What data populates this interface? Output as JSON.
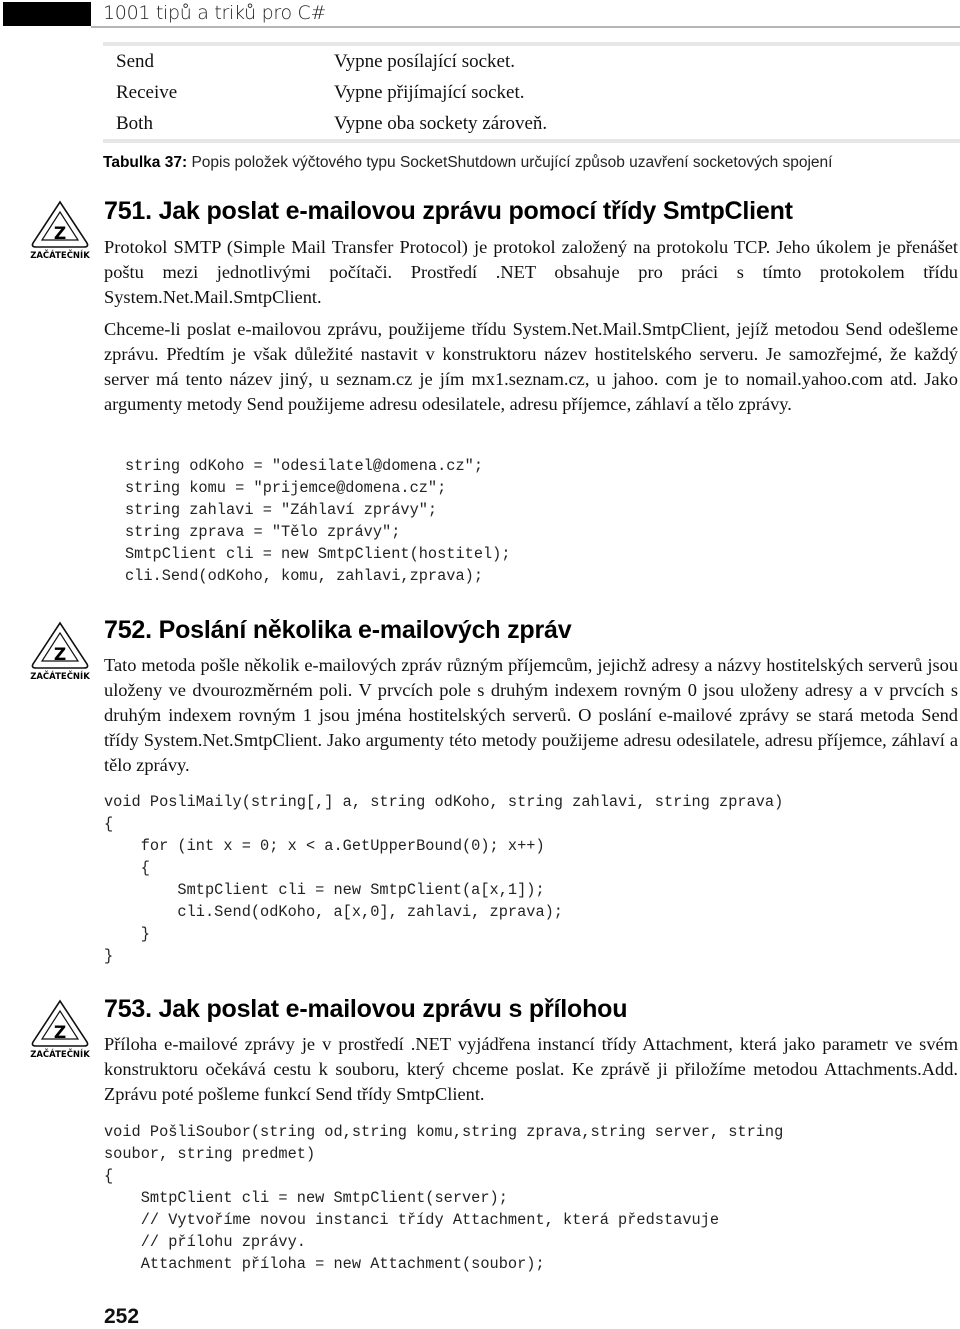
{
  "header": {
    "title": "1001 tipů a triků pro C#"
  },
  "table": {
    "rows": [
      {
        "key": "Send",
        "value": "Vypne posílající socket."
      },
      {
        "key": "Receive",
        "value": "Vypne přijímající socket."
      },
      {
        "key": "Both",
        "value": "Vypne oba sockety zároveň."
      }
    ],
    "caption_label": "Tabulka 37:",
    "caption_text": " Popis položek výčtového typu SocketShutdown určující způsob uzavření socketových spojení"
  },
  "badge": {
    "label": "ZAČÁTEČNÍK",
    "letter": "Z",
    "icon": "beginner-triangle-icon"
  },
  "sections": [
    {
      "title": "751. Jak poslat e-mailovou zprávu pomocí třídy SmtpClient",
      "paragraphs": [
        "Protokol SMTP (Simple Mail Transfer Protocol) je protokol založený na protokolu TCP. Jeho úkolem je přenášet poštu mezi jednotlivými počítači. Prostředí .NET obsahuje pro práci s tímto protokolem třídu System.Net.Mail.SmtpClient.",
        "Chceme-li poslat e-mailovou zprávu, použijeme třídu System.Net.Mail.SmtpClient, jejíž metodou Send odešleme zprávu. Předtím je však důležité nastavit v konstruktoru název hostitelského serveru. Je samozřejmé, že každý server má tento název jiný, u seznam.cz je jím mx1.seznam.cz, u jahoo. com je to nomail.yahoo.com atd. Jako argumenty metody Send použijeme adresu odesilatele, adresu příjemce, záhlaví a tělo zprávy."
      ],
      "code": [
        "string odKoho = \"odesilatel@domena.cz\";",
        "string komu = \"prijemce@domena.cz\";",
        "string zahlavi = \"Záhlaví zprávy\";",
        "string zprava = \"Tělo zprávy\";",
        "SmtpClient cli = new SmtpClient(hostitel);",
        "cli.Send(odKoho, komu, zahlavi,zprava);"
      ]
    },
    {
      "title": "752. Poslání několika e-mailových zpráv",
      "paragraphs": [
        "Tato metoda pošle několik e-mailových zpráv různým příjemcům, jejichž adresy a názvy hostitelských serverů jsou uloženy ve dvourozměrném poli. V prvcích pole s druhým indexem rovným 0 jsou uloženy adresy a v prvcích s druhým indexem rovným 1 jsou jména hostitelských serverů. O poslání e-mailové zprávy se stará metoda Send třídy System.Net.SmtpClient. Jako argumenty této metody použijeme adresu odesilatele, adresu příjemce, záhlaví a tělo zprávy."
      ],
      "code": [
        "void PosliMaily(string[,] a, string odKoho, string zahlavi, string zprava)",
        "{",
        "    for (int x = 0; x < a.GetUpperBound(0); x++)",
        "    {",
        "        SmtpClient cli = new SmtpClient(a[x,1]);",
        "        cli.Send(odKoho, a[x,0], zahlavi, zprava);",
        "    }",
        "}"
      ]
    },
    {
      "title": "753. Jak poslat e-mailovou zprávu s přílohou",
      "paragraphs": [
        "Příloha e-mailové zprávy je v prostředí .NET vyjádřena instancí třídy Attachment, která jako parametr ve svém konstruktoru očekává cestu k souboru, který chceme poslat. Ke zprávě ji přiložíme metodou Attachments.Add. Zprávu poté pošleme funkcí Send třídy SmtpClient."
      ],
      "code": [
        "void PošliSoubor(string od,string komu,string zprava,string server, string",
        "soubor, string predmet)",
        "{",
        "    SmtpClient cli = new SmtpClient(server);",
        "    // Vytvoříme novou instanci třídy Attachment, která představuje",
        "    // přílohu zprávy.",
        "    Attachment příloha = new Attachment(soubor);"
      ]
    }
  ],
  "footer": {
    "page_number": "252"
  }
}
